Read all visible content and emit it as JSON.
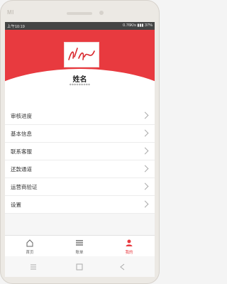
{
  "device": {
    "brand": "MI"
  },
  "statusbar": {
    "time": "上午10:19",
    "network": "0.76K/s",
    "battery": "37%"
  },
  "profile": {
    "name": "姓名",
    "masked_phone": "*********"
  },
  "menu": {
    "items": [
      {
        "label": "审核进度"
      },
      {
        "label": "基本信息"
      },
      {
        "label": "联系客服"
      },
      {
        "label": "还款通道"
      },
      {
        "label": "运营商验证"
      },
      {
        "label": "设置"
      }
    ]
  },
  "tabbar": {
    "tabs": [
      {
        "label": "首页",
        "icon": "home-icon"
      },
      {
        "label": "账单",
        "icon": "list-icon"
      },
      {
        "label": "我的",
        "icon": "person-icon",
        "active": true
      }
    ]
  },
  "colors": {
    "accent": "#e83a3f",
    "background": "#f6f6f6"
  }
}
